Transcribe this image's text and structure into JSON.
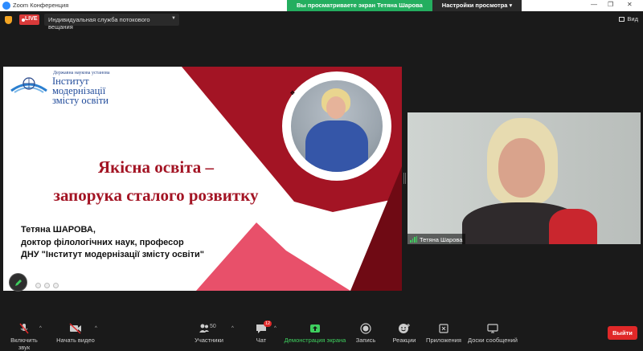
{
  "window": {
    "title": "Zoom Конференция"
  },
  "share_bar": {
    "message": "Вы просматриваете экран Тетяна Шарова",
    "options_label": "Настройки просмотра"
  },
  "top_bar": {
    "live_label": "LIVE",
    "stream_service": "Индивидуальная служба потокового вещания",
    "view_label": "Вид"
  },
  "slide": {
    "logo_small": "Державна наукова установа",
    "logo_lines": [
      "Інститут",
      "модернізації",
      "змісту освіти"
    ],
    "title_lines": [
      "Якісна освіта –",
      "запорука сталого розвитку"
    ],
    "author_lines": [
      "Тетяна ШАРОВА,",
      "доктор філологічних наук, професор",
      "ДНУ \"Інститут модернізації змісту освіти\""
    ]
  },
  "video": {
    "participant_name": "Тетяна Шарова"
  },
  "toolbar": {
    "mute": "Включить звук",
    "video": "Начать видео",
    "participants": "Участники",
    "participants_count": "50",
    "chat": "Чат",
    "chat_badge": "12",
    "share": "Демонстрация экрана",
    "record": "Запись",
    "reactions": "Реакции",
    "apps": "Приложения",
    "whiteboard": "Доски сообщений",
    "leave": "Выйти"
  },
  "colors": {
    "accent_red": "#a31424",
    "slide_pink": "#e0405a",
    "share_green": "#24ae5f",
    "leave_red": "#e02828"
  }
}
